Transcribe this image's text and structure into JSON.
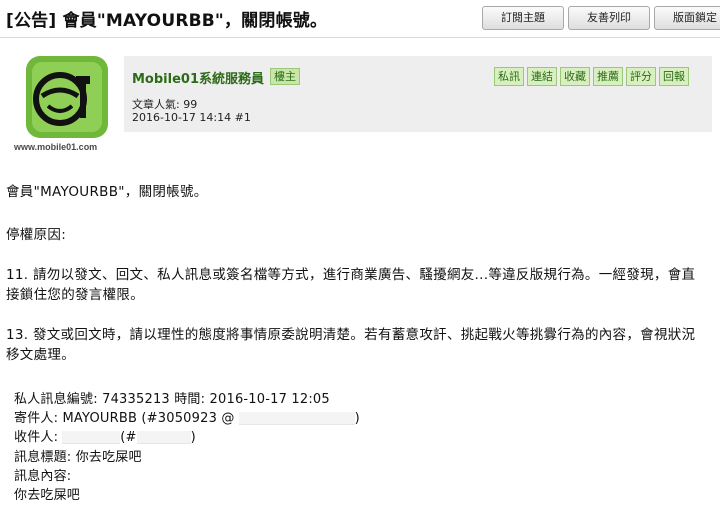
{
  "header": {
    "title": "[公告] 會員\"MAYOURBB\"，關閉帳號。",
    "buttons": [
      {
        "label": "訂閱主題"
      },
      {
        "label": "友善列印"
      },
      {
        "label": "版面鎖定"
      }
    ]
  },
  "post": {
    "poster_name": "Mobile01系統服務員",
    "role_badge": "樓主",
    "logo_caption": "www.mobile01.com",
    "popularity": "文章人氣: 99",
    "datetime_floor": "2016-10-17 14:14  #1",
    "actions": [
      {
        "label": "私訊"
      },
      {
        "label": "連結"
      },
      {
        "label": "收藏"
      },
      {
        "label": "推薦"
      },
      {
        "label": "評分"
      },
      {
        "label": "回報"
      }
    ],
    "paragraphs": [
      "會員\"MAYOURBB\"，關閉帳號。",
      "停權原因:",
      "11. 請勿以發文、回文、私人訊息或簽名檔等方式，進行商業廣告、騷擾網友...等違反版規行為。一經發現，會直接鎖住您的發言權限。",
      "13. 發文或回文時，請以理性的態度將事情原委說明清楚。若有蓄意攻訐、挑起戰火等挑釁行為的內容，會視狀況移文處理。"
    ],
    "pm": {
      "line1": "私人訊息編號: 74335213 時間: 2016-10-17 12:05",
      "sender_prefix": "寄件人: MAYOURBB (#3050923 @",
      "sender_suffix": ")",
      "recipient_prefix": "收件人:",
      "recipient_mid": "(#",
      "recipient_suffix": ")",
      "subject": "訊息標題: 你去吃屎吧",
      "content_label": "訊息內容:",
      "content": "你去吃屎吧"
    }
  },
  "colors": {
    "brand_green": "#2d6b18",
    "badge_bg": "#d8efc0",
    "header_bg": "#eeeeee",
    "logo_green": "#7cc243"
  }
}
